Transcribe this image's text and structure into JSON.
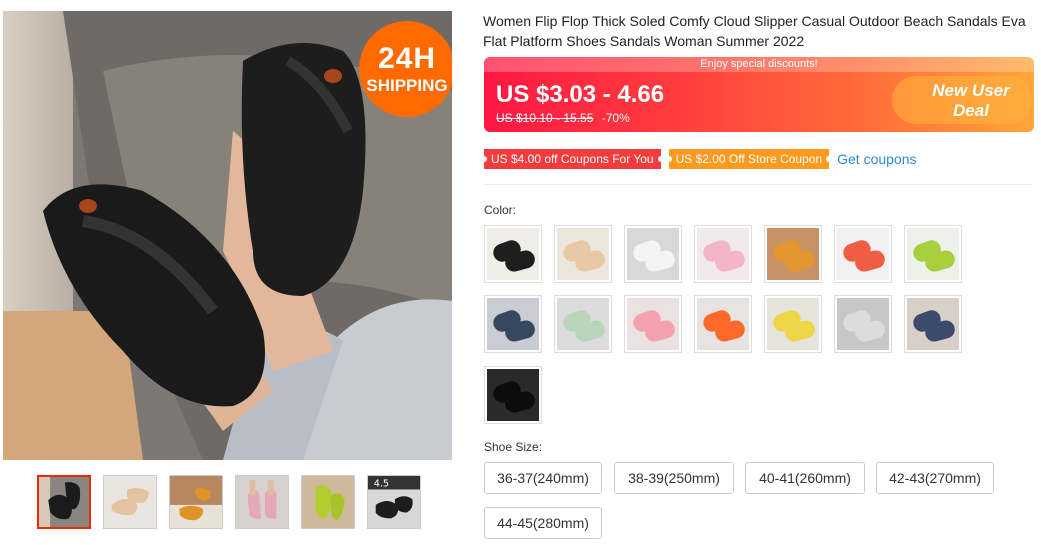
{
  "gallery": {
    "badge_line1": "24H",
    "badge_line2": "SHIPPING",
    "main_icon": "product-photo-black-flip-flops",
    "thumbnails": [
      {
        "icon": "black-flip-flop-thumb",
        "active": true
      },
      {
        "icon": "beige-flip-flop-thumb",
        "active": false
      },
      {
        "icon": "brown-flip-flop-thumb",
        "active": false
      },
      {
        "icon": "pink-flip-flop-thumb",
        "active": false
      },
      {
        "icon": "green-flip-flop-thumb",
        "active": false
      },
      {
        "icon": "size-chart-thumb",
        "label": "4.5",
        "active": false
      }
    ]
  },
  "product": {
    "title": "Women Flip Flop Thick Soled Comfy Cloud Slipper Casual Outdoor Beach Sandals Eva Flat Platform Shoes Sandals Woman Summer 2022"
  },
  "price": {
    "banner": "Enjoy special discounts!",
    "current": "US $3.03 - 4.66",
    "original": "US $10.10 - 15.55",
    "discount": "-70%",
    "new_user_line1": "New User",
    "new_user_line2": "Deal"
  },
  "coupons": {
    "coupon1": "US $4.00 off Coupons For You",
    "coupon2": "US $2.00 Off Store Coupon",
    "get_link": "Get coupons"
  },
  "color": {
    "label": "Color:",
    "swatches": [
      {
        "name": "Black",
        "color": "#1e1e1e",
        "bg": "#f0ece6"
      },
      {
        "name": "Beige",
        "color": "#e7c9a6",
        "bg": "#ede6dc"
      },
      {
        "name": "White",
        "color": "#f4f4f4",
        "bg": "#d8d8d8"
      },
      {
        "name": "Pink",
        "color": "#f2b6c7",
        "bg": "#f1e9ec"
      },
      {
        "name": "Brown",
        "color": "#e3962e",
        "bg": "#c89266"
      },
      {
        "name": "Orange",
        "color": "#ee5d44",
        "bg": "#f1f1f1"
      },
      {
        "name": "Green",
        "color": "#a7cf3e",
        "bg": "#eef1ea"
      },
      {
        "name": "Navy slide",
        "color": "#36475e",
        "bg": "#c9cdd3"
      },
      {
        "name": "Mint slide",
        "color": "#b9d6bb",
        "bg": "#dcdcdc"
      },
      {
        "name": "Pink slide",
        "color": "#f2a2ad",
        "bg": "#eae2e2"
      },
      {
        "name": "Orange slide",
        "color": "#ff6a2a",
        "bg": "#e6e3e0"
      },
      {
        "name": "Yellow slide",
        "color": "#efd649",
        "bg": "#e6e3da"
      },
      {
        "name": "Grey slide",
        "color": "#dddcdc",
        "bg": "#c7c7c7"
      },
      {
        "name": "Dark blue slide",
        "color": "#3c4a6e",
        "bg": "#d8d0c6"
      },
      {
        "name": "Black slide",
        "color": "#0c0c0c",
        "bg": "#2a2a2a"
      }
    ]
  },
  "size": {
    "label": "Shoe Size:",
    "options": [
      "36-37(240mm)",
      "38-39(250mm)",
      "40-41(260mm)",
      "42-43(270mm)",
      "44-45(280mm)"
    ]
  }
}
